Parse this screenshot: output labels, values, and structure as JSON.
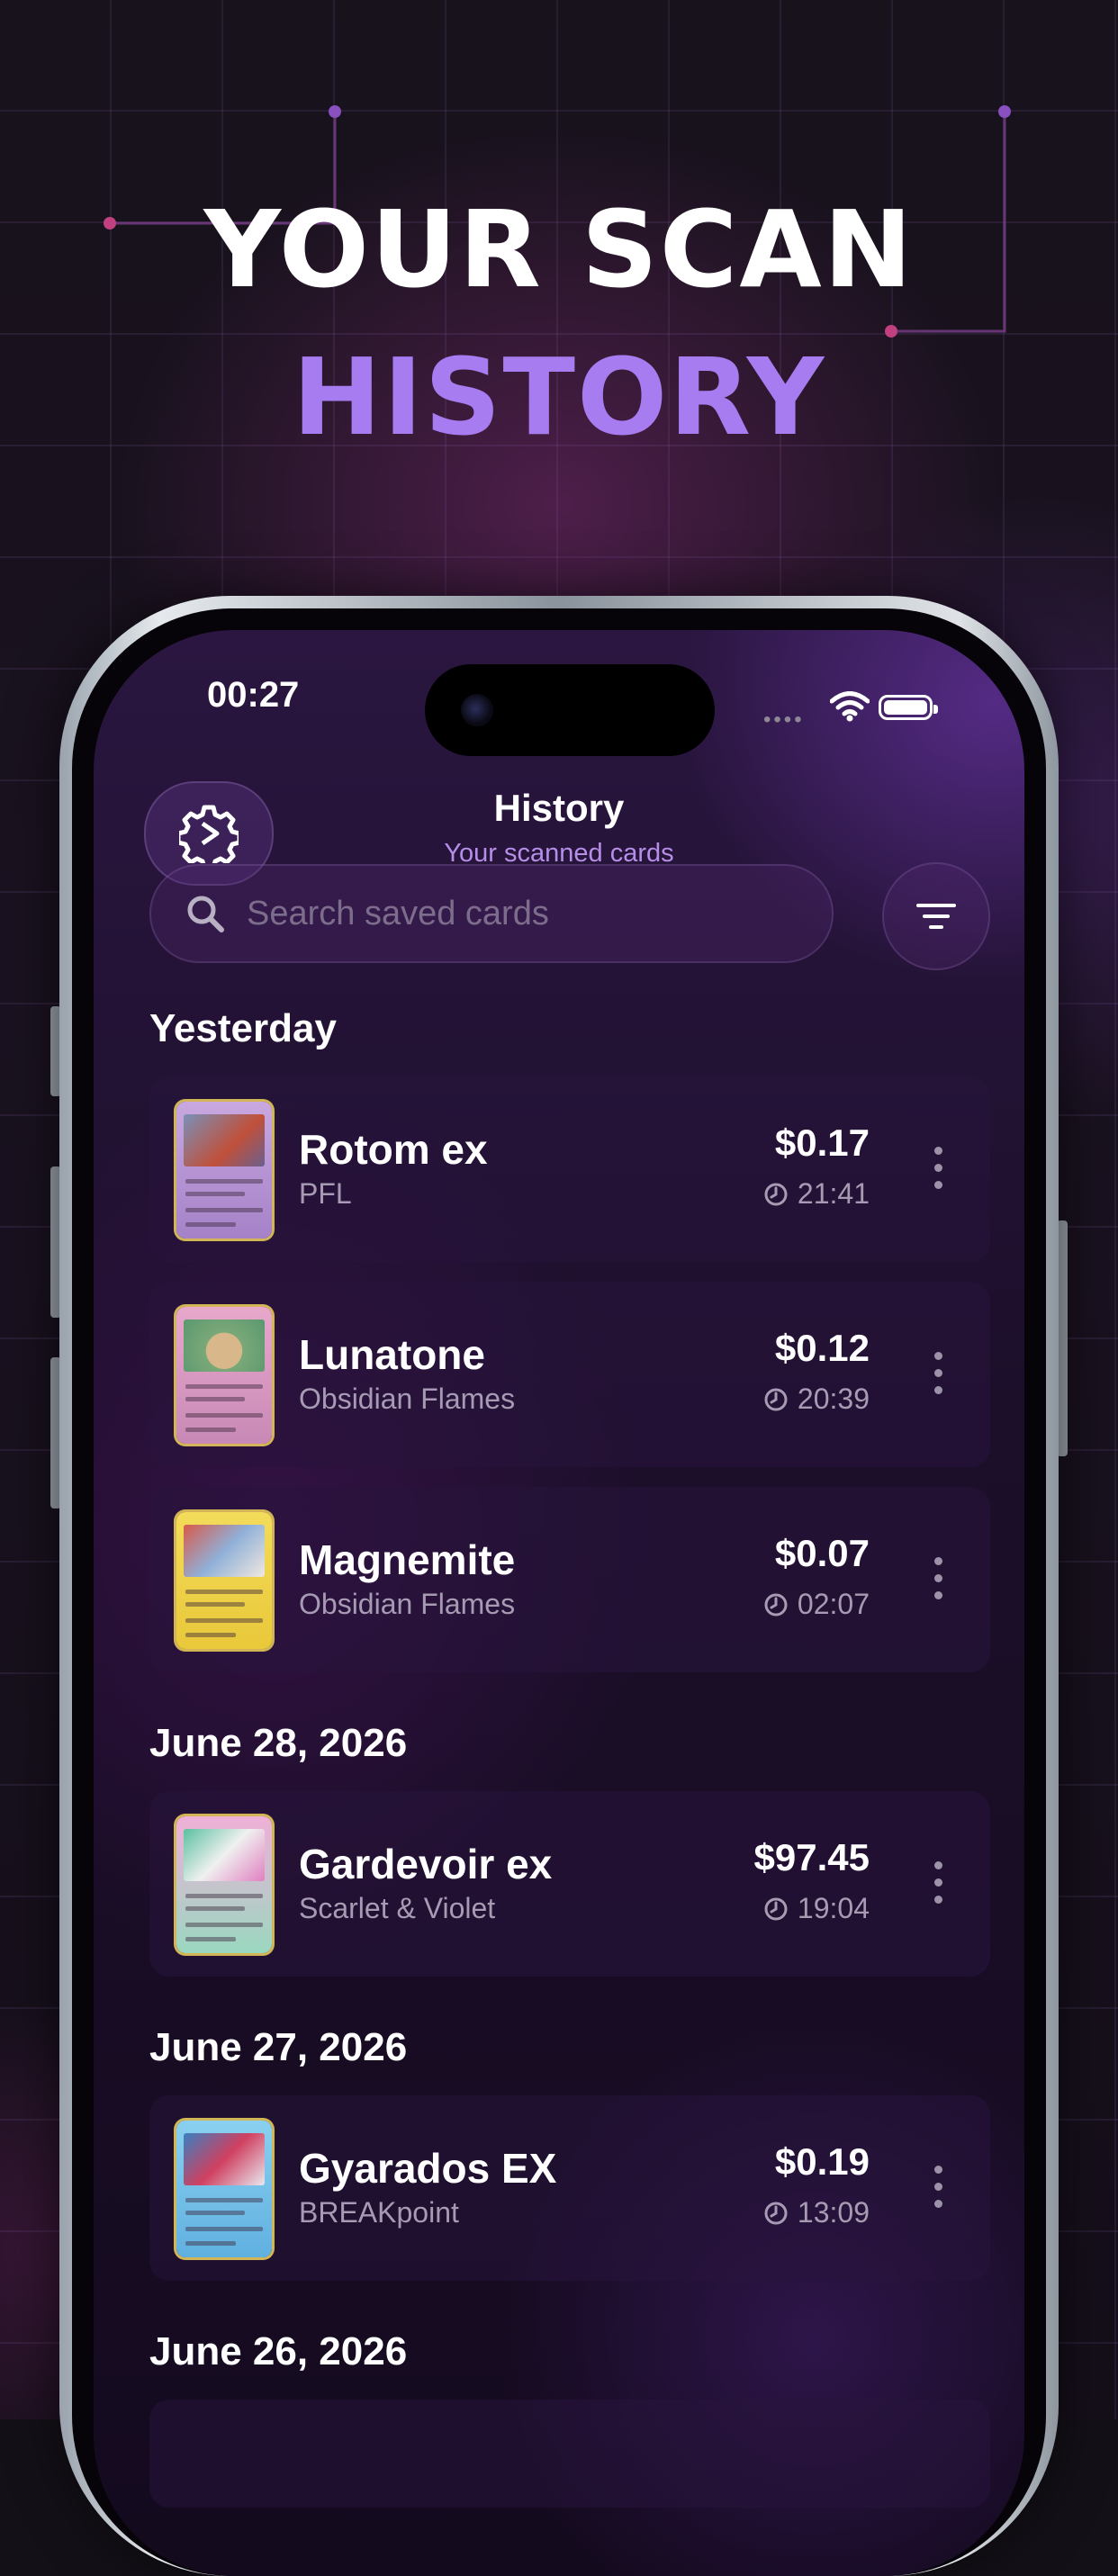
{
  "headline": {
    "line1": "YOUR SCAN",
    "line2": "HISTORY"
  },
  "status_bar": {
    "time": "00:27"
  },
  "header": {
    "title": "History",
    "subtitle": "Your scanned cards"
  },
  "search": {
    "placeholder": "Search saved cards"
  },
  "sections": [
    {
      "label": "Yesterday",
      "cards": [
        {
          "name": "Rotom ex",
          "set": "PFL",
          "price": "$0.17",
          "time": "21:41"
        },
        {
          "name": "Lunatone",
          "set": "Obsidian Flames",
          "price": "$0.12",
          "time": "20:39"
        },
        {
          "name": "Magnemite",
          "set": "Obsidian Flames",
          "price": "$0.07",
          "time": "02:07"
        }
      ]
    },
    {
      "label": "June 28, 2026",
      "cards": [
        {
          "name": "Gardevoir ex",
          "set": "Scarlet & Violet",
          "price": "$97.45",
          "time": "19:04"
        }
      ]
    },
    {
      "label": "June 27, 2026",
      "cards": [
        {
          "name": "Gyarados EX",
          "set": "BREAKpoint",
          "price": "$0.19",
          "time": "13:09"
        }
      ]
    },
    {
      "label": "June 26, 2026",
      "cards": []
    }
  ],
  "colors": {
    "accent": "#a77cf0",
    "subtitle": "#b58ee8",
    "card_bg": "#241433"
  }
}
